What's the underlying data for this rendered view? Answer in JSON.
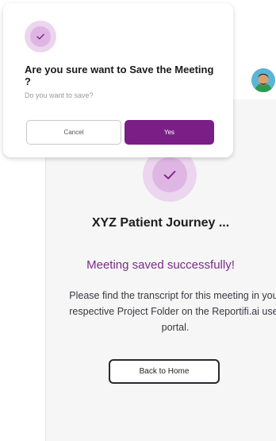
{
  "colors": {
    "accent": "#7a1f86",
    "accent_text": "#7b2b87",
    "check_light": "#ecd5ee",
    "check_mid": "#dfb6e3"
  },
  "modal": {
    "icon": "check-icon",
    "title": "Are you sure want to Save the Meeting ?",
    "subtitle": "Do you want to save?",
    "cancel_label": "Cancel",
    "confirm_label": "Yes"
  },
  "main": {
    "icon": "check-icon",
    "project_title": "XYZ Patient Journey ...",
    "saved_message": "Meeting saved successfully!",
    "description": "Please find the transcript for this meeting in your respective Project Folder on the Reportifi.ai user portal.",
    "home_button_label": "Back to Home"
  },
  "header": {
    "avatar_icon": "user-avatar-icon"
  }
}
